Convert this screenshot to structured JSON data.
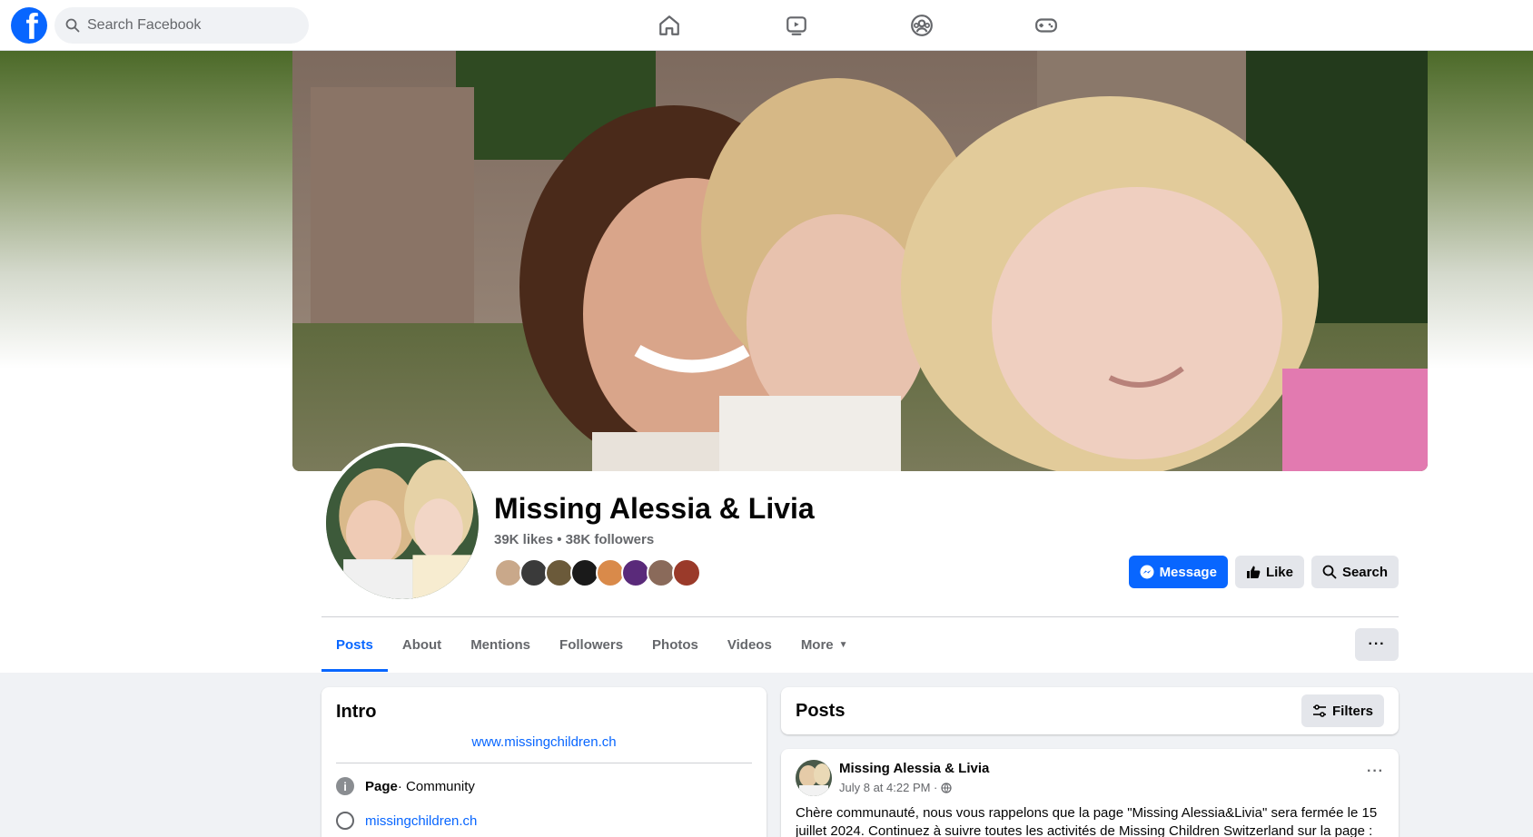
{
  "topbar": {
    "search_placeholder": "Search Facebook",
    "nav_icons": [
      "home-icon",
      "video-icon",
      "groups-icon",
      "gaming-icon"
    ]
  },
  "colors": {
    "brand": "#0866ff",
    "cover_gradient_top": "#4c6a29"
  },
  "page": {
    "name": "Missing Alessia & Livia",
    "stats": "39K likes • 38K followers",
    "follower_faces": [
      "#c9a88a",
      "#3a3a3a",
      "#6b5a3a",
      "#1a1a1a",
      "#d98a4a",
      "#5a2a7a",
      "#8a6a5a",
      "#9a3a2a"
    ]
  },
  "actions": {
    "message": "Message",
    "like": "Like",
    "search": "Search"
  },
  "tabs": {
    "items": [
      {
        "label": "Posts",
        "active": true
      },
      {
        "label": "About"
      },
      {
        "label": "Mentions"
      },
      {
        "label": "Followers"
      },
      {
        "label": "Photos"
      },
      {
        "label": "Videos"
      },
      {
        "label": "More"
      }
    ],
    "more_dots": "···"
  },
  "intro": {
    "title": "Intro",
    "website_top": "www.missingchildren.ch",
    "category_label": "Page",
    "category_value": " · Community",
    "website": "missingchildren.ch"
  },
  "posts": {
    "title": "Posts",
    "filters": "Filters"
  },
  "post": {
    "author": "Missing Alessia & Livia",
    "time": "July 8 at 4:22 PM ·",
    "dots": "···",
    "text": "Chère communauté, nous vous rappelons que la page \"Missing Alessia&Livia\" sera fermée le 15 juillet 2024. Continuez à suivre toutes les activités de Missing Children Switzerland sur la page :"
  }
}
